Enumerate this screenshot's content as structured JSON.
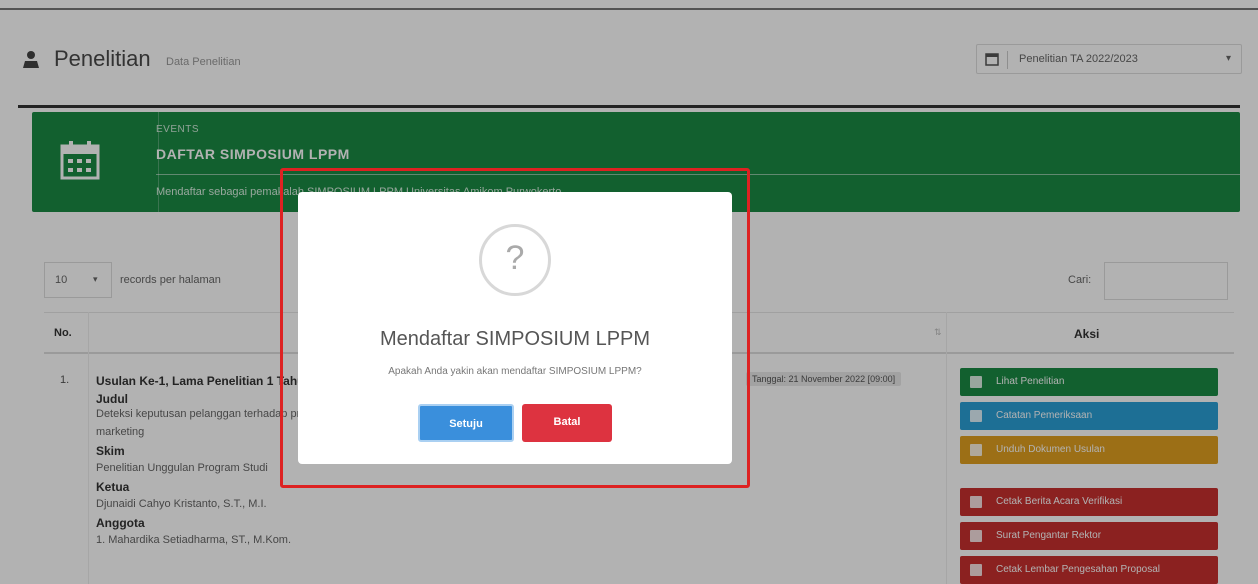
{
  "header": {
    "title": "Penelitian",
    "subtitle": "Data Penelitian",
    "period_select": "Penelitian TA 2022/2023"
  },
  "event": {
    "label": "EVENTS",
    "title": "DAFTAR SIMPOSIUM LPPM",
    "description": "Mendaftar sebagai pemakalah SIMPOSIUM LPPM Universitas Amikom Purwokerto"
  },
  "table_controls": {
    "page_length": "10",
    "length_label": "records per halaman",
    "search_label": "Cari:"
  },
  "table": {
    "col_no": "No.",
    "col_aksi": "Aksi",
    "rows": [
      {
        "no": "1.",
        "head": "Usulan Ke-1, Lama Penelitian 1 Tahun",
        "badge": "Tanggal: 21 November 2022 [09:00]",
        "judul_label": "Judul",
        "judul_value": "Deteksi keputusan pelanggan terhadap produk berbasis sistem pendukung keputusan berbasis web dan pemasaran digital",
        "judul_value2": "marketing",
        "skim_label": "Skim",
        "skim_value": "Penelitian Unggulan Program Studi",
        "ketua_label": "Ketua",
        "ketua_value": "Djunaidi Cahyo Kristanto, S.T., M.I.",
        "anggota_label": "Anggota",
        "anggota_value": "1. Mahardika Setiadharma, ST., M.Kom."
      }
    ],
    "actions": [
      {
        "label": "Lihat Penelitian",
        "color": "#1a8a44",
        "icon": "file-icon"
      },
      {
        "label": "Catatan Pemeriksaan",
        "color": "#2aa0d6",
        "icon": "search-icon"
      },
      {
        "label": "Unduh Dokumen Usulan",
        "color": "#e0a020",
        "icon": "download-icon"
      },
      {
        "label": "Cetak Berita Acara Verifikasi",
        "color": "#c8302f",
        "icon": "print-icon"
      },
      {
        "label": "Surat Pengantar Rektor",
        "color": "#c8302f",
        "icon": "print-icon"
      },
      {
        "label": "Cetak Lembar Pengesahan Proposal",
        "color": "#c8302f",
        "icon": "print-icon"
      }
    ]
  },
  "modal": {
    "icon": "question-icon",
    "glyph": "?",
    "title": "Mendaftar SIMPOSIUM LPPM",
    "text": "Apakah Anda yakin akan mendaftar SIMPOSIUM LPPM?",
    "ok_label": "Setuju",
    "cancel_label": "Batal"
  }
}
